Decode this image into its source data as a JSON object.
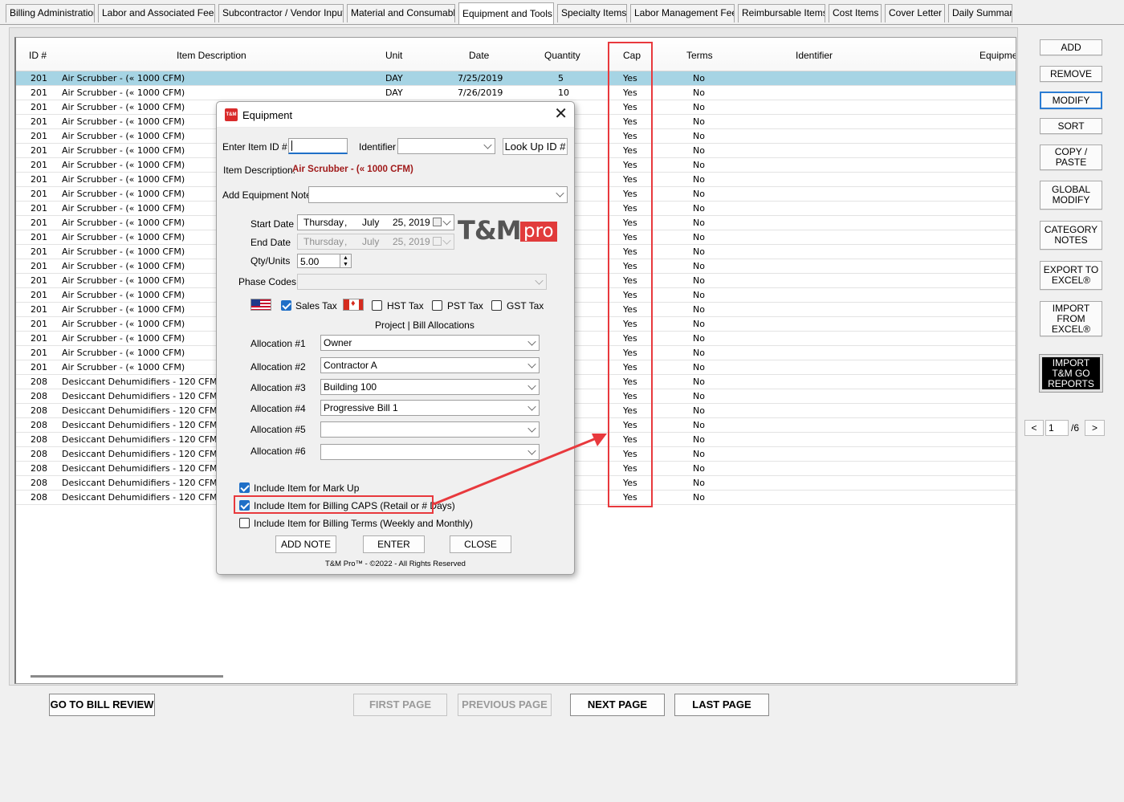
{
  "tabs": [
    {
      "label": "Billing Administration",
      "active": false
    },
    {
      "label": "Labor and Associated Fees",
      "active": false
    },
    {
      "label": "Subcontractor / Vendor Input",
      "active": false
    },
    {
      "label": "Material and Consumable",
      "active": false
    },
    {
      "label": "Equipment and Tools",
      "active": true
    },
    {
      "label": "Specialty Items",
      "active": false
    },
    {
      "label": "Labor Management Fee",
      "active": false
    },
    {
      "label": "Reimbursable Items",
      "active": false
    },
    {
      "label": "Cost Items",
      "active": false
    },
    {
      "label": "Cover Letter",
      "active": false
    },
    {
      "label": "Daily Summary",
      "active": false
    }
  ],
  "grid": {
    "columns": [
      "ID #",
      "Item Description",
      "Unit",
      "Date",
      "Quantity",
      "Cap",
      "Terms",
      "Identifier",
      "Equipme"
    ],
    "rows": [
      {
        "id": "201",
        "desc": "Air Scrubber - (« 1000 CFM)",
        "unit": "DAY",
        "date": "7/25/2019",
        "qty": "5",
        "cap": "Yes",
        "terms": "No",
        "selected": true
      },
      {
        "id": "201",
        "desc": "Air Scrubber - (« 1000 CFM)",
        "unit": "DAY",
        "date": "7/26/2019",
        "qty": "10",
        "cap": "Yes",
        "terms": "No"
      },
      {
        "id": "201",
        "desc": "Air Scrubber - (« 1000 CFM)",
        "unit": "",
        "date": "",
        "qty": "",
        "cap": "Yes",
        "terms": "No"
      },
      {
        "id": "201",
        "desc": "Air Scrubber - (« 1000 CFM)",
        "unit": "",
        "date": "",
        "qty": "",
        "cap": "Yes",
        "terms": "No"
      },
      {
        "id": "201",
        "desc": "Air Scrubber - (« 1000 CFM)",
        "unit": "",
        "date": "",
        "qty": "",
        "cap": "Yes",
        "terms": "No"
      },
      {
        "id": "201",
        "desc": "Air Scrubber - (« 1000 CFM)",
        "unit": "",
        "date": "",
        "qty": "",
        "cap": "Yes",
        "terms": "No"
      },
      {
        "id": "201",
        "desc": "Air Scrubber - (« 1000 CFM)",
        "unit": "",
        "date": "",
        "qty": "",
        "cap": "Yes",
        "terms": "No"
      },
      {
        "id": "201",
        "desc": "Air Scrubber - (« 1000 CFM)",
        "unit": "",
        "date": "",
        "qty": "",
        "cap": "Yes",
        "terms": "No"
      },
      {
        "id": "201",
        "desc": "Air Scrubber - (« 1000 CFM)",
        "unit": "",
        "date": "",
        "qty": "",
        "cap": "Yes",
        "terms": "No"
      },
      {
        "id": "201",
        "desc": "Air Scrubber - (« 1000 CFM)",
        "unit": "",
        "date": "",
        "qty": "",
        "cap": "Yes",
        "terms": "No"
      },
      {
        "id": "201",
        "desc": "Air Scrubber - (« 1000 CFM)",
        "unit": "",
        "date": "",
        "qty": "",
        "cap": "Yes",
        "terms": "No"
      },
      {
        "id": "201",
        "desc": "Air Scrubber - (« 1000 CFM)",
        "unit": "",
        "date": "",
        "qty": "",
        "cap": "Yes",
        "terms": "No"
      },
      {
        "id": "201",
        "desc": "Air Scrubber - (« 1000 CFM)",
        "unit": "",
        "date": "",
        "qty": "",
        "cap": "Yes",
        "terms": "No"
      },
      {
        "id": "201",
        "desc": "Air Scrubber - (« 1000 CFM)",
        "unit": "",
        "date": "",
        "qty": "",
        "cap": "Yes",
        "terms": "No"
      },
      {
        "id": "201",
        "desc": "Air Scrubber - (« 1000 CFM)",
        "unit": "",
        "date": "",
        "qty": "",
        "cap": "Yes",
        "terms": "No"
      },
      {
        "id": "201",
        "desc": "Air Scrubber - (« 1000 CFM)",
        "unit": "",
        "date": "",
        "qty": "",
        "cap": "Yes",
        "terms": "No"
      },
      {
        "id": "201",
        "desc": "Air Scrubber - (« 1000 CFM)",
        "unit": "",
        "date": "",
        "qty": "",
        "cap": "Yes",
        "terms": "No"
      },
      {
        "id": "201",
        "desc": "Air Scrubber - (« 1000 CFM)",
        "unit": "",
        "date": "",
        "qty": "",
        "cap": "Yes",
        "terms": "No"
      },
      {
        "id": "201",
        "desc": "Air Scrubber - (« 1000 CFM)",
        "unit": "",
        "date": "",
        "qty": "",
        "cap": "Yes",
        "terms": "No"
      },
      {
        "id": "201",
        "desc": "Air Scrubber - (« 1000 CFM)",
        "unit": "",
        "date": "",
        "qty": "",
        "cap": "Yes",
        "terms": "No"
      },
      {
        "id": "201",
        "desc": "Air Scrubber - (« 1000 CFM)",
        "unit": "",
        "date": "",
        "qty": "",
        "cap": "Yes",
        "terms": "No"
      },
      {
        "id": "208",
        "desc": "Desiccant Dehumidifiers - 120 CFM",
        "unit": "",
        "date": "",
        "qty": "",
        "cap": "Yes",
        "terms": "No"
      },
      {
        "id": "208",
        "desc": "Desiccant Dehumidifiers - 120 CFM",
        "unit": "",
        "date": "",
        "qty": "",
        "cap": "Yes",
        "terms": "No"
      },
      {
        "id": "208",
        "desc": "Desiccant Dehumidifiers - 120 CFM",
        "unit": "",
        "date": "",
        "qty": "",
        "cap": "Yes",
        "terms": "No"
      },
      {
        "id": "208",
        "desc": "Desiccant Dehumidifiers - 120 CFM",
        "unit": "",
        "date": "",
        "qty": "",
        "cap": "Yes",
        "terms": "No"
      },
      {
        "id": "208",
        "desc": "Desiccant Dehumidifiers - 120 CFM",
        "unit": "",
        "date": "",
        "qty": "",
        "cap": "Yes",
        "terms": "No"
      },
      {
        "id": "208",
        "desc": "Desiccant Dehumidifiers - 120 CFM",
        "unit": "",
        "date": "",
        "qty": "",
        "cap": "Yes",
        "terms": "No"
      },
      {
        "id": "208",
        "desc": "Desiccant Dehumidifiers - 120 CFM",
        "unit": "",
        "date": "",
        "qty": "",
        "cap": "Yes",
        "terms": "No"
      },
      {
        "id": "208",
        "desc": "Desiccant Dehumidifiers - 120 CFM",
        "unit": "",
        "date": "",
        "qty": "",
        "cap": "Yes",
        "terms": "No"
      },
      {
        "id": "208",
        "desc": "Desiccant Dehumidifiers - 120 CFM",
        "unit": "",
        "date": "",
        "qty": "",
        "cap": "Yes",
        "terms": "No"
      }
    ]
  },
  "side_buttons": [
    {
      "label": "ADD"
    },
    {
      "label": "REMOVE"
    },
    {
      "label": "MODIFY"
    },
    {
      "label": "SORT"
    },
    {
      "label": "COPY /\nPASTE"
    },
    {
      "label": "GLOBAL\nMODIFY"
    },
    {
      "label": "CATEGORY\nNOTES"
    },
    {
      "label": "EXPORT TO\nEXCEL®"
    },
    {
      "label": "IMPORT\nFROM\nEXCEL®"
    },
    {
      "label": "IMPORT\nT&M GO\nREPORTS"
    }
  ],
  "pager": {
    "prev": "<",
    "page": "1",
    "total": "/6",
    "next": ">"
  },
  "bottom_nav": {
    "bill_review": "GO TO BILL REVIEW",
    "first": "FIRST PAGE",
    "previous": "PREVIOUS PAGE",
    "next": "NEXT PAGE",
    "last": "LAST PAGE"
  },
  "dialog": {
    "title": "Equipment",
    "icon_text": "T&M",
    "enter_item_label": "Enter Item ID #",
    "item_id_value": "",
    "identifier_label": "Identifier",
    "lookup_button": "Look Up ID #",
    "item_desc_label": "Item Description:",
    "item_desc_value": "Air Scrubber - (« 1000 CFM)",
    "add_note_label": "Add Equipment Note",
    "start_date_label": "Start Date",
    "start_date": {
      "weekday": "Thursday",
      "month": "July",
      "day_year": "25, 2019"
    },
    "end_date_label": "End Date",
    "end_date": {
      "weekday": "Thursday",
      "month": "July",
      "day_year": "25, 2019"
    },
    "qty_label": "Qty/Units",
    "qty_value": "5.00",
    "phase_label": "Phase Codes",
    "logo_tm": "T&M",
    "logo_pro": "pro",
    "taxes": {
      "sales": "Sales Tax",
      "hst": "HST Tax",
      "pst": "PST Tax",
      "gst": "GST Tax"
    },
    "allocations_title": "Project | Bill Allocations",
    "allocations": [
      {
        "label": "Allocation #1",
        "value": "Owner"
      },
      {
        "label": "Allocation #2",
        "value": "Contractor A"
      },
      {
        "label": "Allocation #3",
        "value": "Building 100"
      },
      {
        "label": "Allocation #4",
        "value": "Progressive Bill 1"
      },
      {
        "label": "Allocation #5",
        "value": ""
      },
      {
        "label": "Allocation #6",
        "value": ""
      }
    ],
    "checks": {
      "markup": "Include Item for Mark Up",
      "caps": "Include Item for Billing CAPS (Retail or # Days)",
      "terms": "Include Item for Billing Terms (Weekly and Monthly)"
    },
    "buttons": {
      "add_note": "ADD NOTE",
      "enter": "ENTER",
      "close": "CLOSE"
    },
    "footer": "T&M Pro™ - ©2022 - All Rights Reserved"
  },
  "colors": {
    "selection": "#a6d4e4",
    "annotation": "#e8393d",
    "accent": "#1f6fc7"
  }
}
